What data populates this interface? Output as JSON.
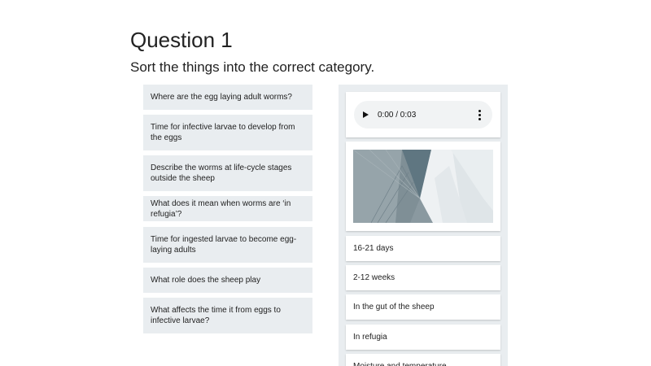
{
  "question": {
    "title": "Question 1",
    "instruction": "Sort the things into the correct category."
  },
  "items": [
    "Where are the egg laying adult worms?",
    "Time for infective larvae to develop from the eggs",
    "Describe the worms at life-cycle stages outside the sheep",
    "What does it mean when worms are ‘in refugia’?",
    "Time for ingested larvae to become egg-laying adults",
    "What role does the sheep play",
    "What affects the time it from eggs to infective larvae?"
  ],
  "answers": {
    "audio": {
      "time": "0:00 / 0:03"
    },
    "image": {
      "icon": "abstract-grey-image"
    },
    "options": [
      "16-21 days",
      "2-12 weeks",
      "In the gut of the sheep",
      "In refugia",
      "Moisture and temperature"
    ]
  }
}
